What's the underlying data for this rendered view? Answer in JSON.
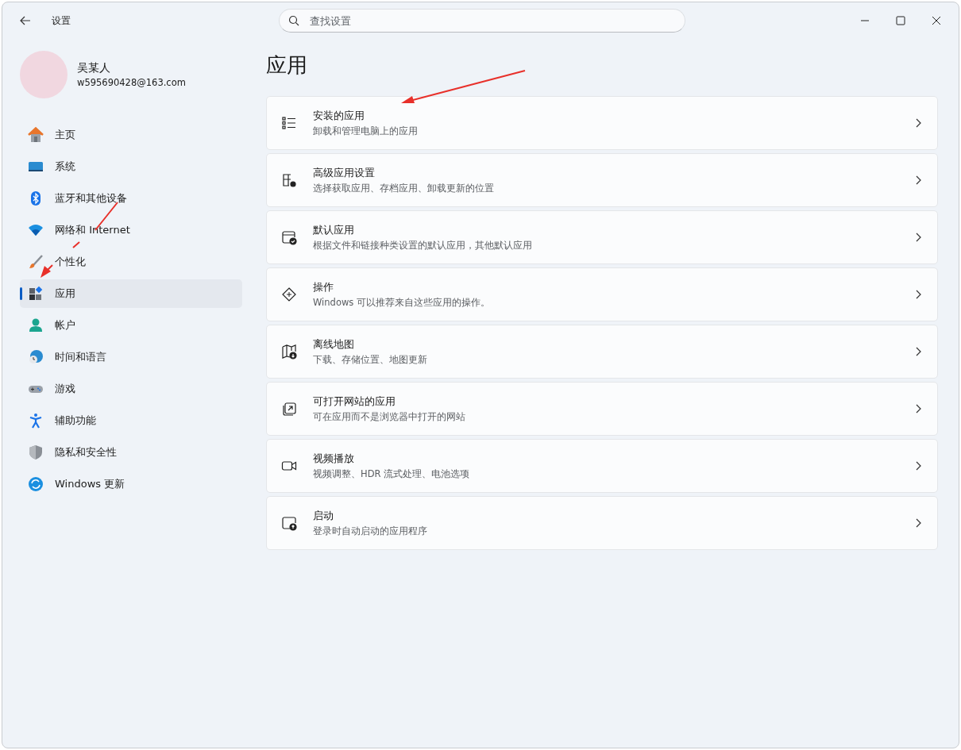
{
  "window": {
    "title": "设置"
  },
  "search": {
    "placeholder": "查找设置"
  },
  "user": {
    "name": "吴某人",
    "email": "w595690428@163.com"
  },
  "nav": [
    {
      "label": "主页",
      "kind": "home",
      "selected": false
    },
    {
      "label": "系统",
      "kind": "system",
      "selected": false
    },
    {
      "label": "蓝牙和其他设备",
      "kind": "bluetooth",
      "selected": false
    },
    {
      "label": "网络和 Internet",
      "kind": "network",
      "selected": false
    },
    {
      "label": "个性化",
      "kind": "brush",
      "selected": false
    },
    {
      "label": "应用",
      "kind": "apps",
      "selected": true
    },
    {
      "label": "帐户",
      "kind": "account",
      "selected": false
    },
    {
      "label": "时间和语言",
      "kind": "time",
      "selected": false
    },
    {
      "label": "游戏",
      "kind": "gaming",
      "selected": false
    },
    {
      "label": "辅助功能",
      "kind": "accessibility",
      "selected": false
    },
    {
      "label": "隐私和安全性",
      "kind": "privacy",
      "selected": false
    },
    {
      "label": "Windows 更新",
      "kind": "update",
      "selected": false
    }
  ],
  "page_title": "应用",
  "cards": [
    {
      "title": "安装的应用",
      "subtitle": "卸载和管理电脑上的应用",
      "kind": "list"
    },
    {
      "title": "高级应用设置",
      "subtitle": "选择获取应用、存档应用、卸载更新的位置",
      "kind": "advanced"
    },
    {
      "title": "默认应用",
      "subtitle": "根据文件和链接种类设置的默认应用，其他默认应用",
      "kind": "default"
    },
    {
      "title": "操作",
      "subtitle": "Windows 可以推荐来自这些应用的操作。",
      "kind": "actions"
    },
    {
      "title": "离线地图",
      "subtitle": "下载、存储位置、地图更新",
      "kind": "map"
    },
    {
      "title": "可打开网站的应用",
      "subtitle": "可在应用而不是浏览器中打开的网站",
      "kind": "web"
    },
    {
      "title": "视频播放",
      "subtitle": "视频调整、HDR 流式处理、电池选项",
      "kind": "video"
    },
    {
      "title": "启动",
      "subtitle": "登录时自动启动的应用程序",
      "kind": "startup"
    }
  ]
}
